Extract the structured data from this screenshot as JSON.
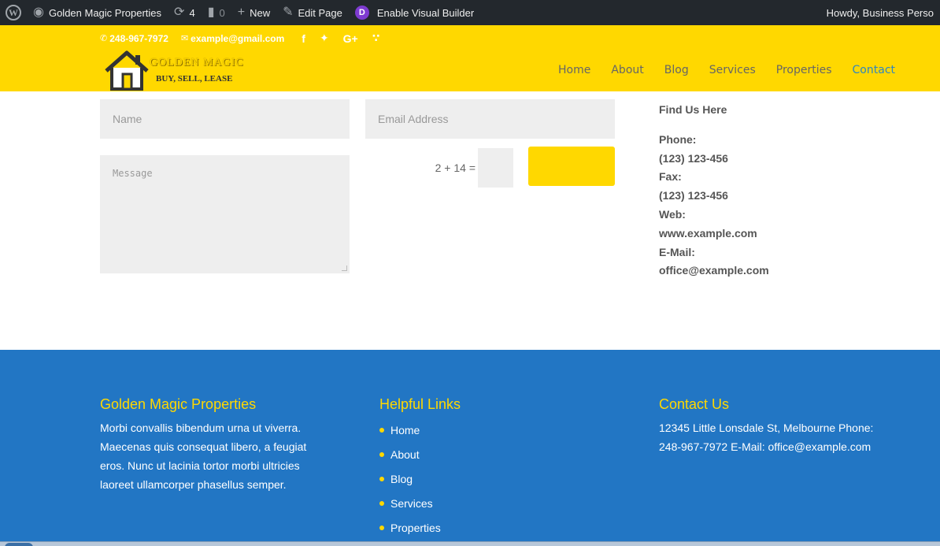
{
  "admin_bar": {
    "site_name": "Golden Magic Properties",
    "updates_count": "4",
    "comments_count": "0",
    "new_label": "New",
    "edit_page_label": "Edit Page",
    "visual_builder_label": "Enable Visual Builder",
    "greeting": "Howdy, Business Perso"
  },
  "header": {
    "phone": "248-967-7972",
    "email": "example@gmail.com",
    "social_icons": [
      "facebook-icon",
      "twitter-icon",
      "google-plus-icon",
      "rss-icon"
    ],
    "logo_title": "GOLDEN MAGIC",
    "logo_tagline": "BUY, SELL, LEASE",
    "nav": [
      {
        "label": "Home"
      },
      {
        "label": "About"
      },
      {
        "label": "Blog"
      },
      {
        "label": "Services"
      },
      {
        "label": "Properties"
      },
      {
        "label": "Contact",
        "active": true
      }
    ]
  },
  "contact_form": {
    "name_placeholder": "Name",
    "email_placeholder": "Email Address",
    "message_placeholder": "Message",
    "captcha_question": "2 + 14 =",
    "captcha_value": ""
  },
  "find_us": {
    "heading": "Find Us Here",
    "phone_label": "Phone:",
    "phone": "(123) 123-456",
    "fax_label": "Fax:",
    "fax": "(123) 123-456",
    "web_label": "Web:",
    "web": "www.example.com",
    "email_label": "E-Mail:",
    "email": "office@example.com"
  },
  "footer": {
    "col1": {
      "title": "Golden Magic Properties",
      "text": "Morbi convallis bibendum urna ut viverra. Maecenas quis consequat libero, a feugiat eros. Nunc ut lacinia tortor morbi ultricies laoreet ullamcorper phasellus semper."
    },
    "col2": {
      "title": "Helpful Links",
      "links": [
        "Home",
        "About",
        "Blog",
        "Services",
        "Properties"
      ]
    },
    "col3": {
      "title": "Contact Us",
      "text": "12345 Little Lonsdale St, Melbourne Phone: 248-967-7972 E-Mail: office@example.com"
    }
  },
  "colors": {
    "brand_yellow": "#ffd800",
    "footer_blue": "#2276c4",
    "admin_bar": "#23282d",
    "nav_active": "#2e86c1"
  }
}
